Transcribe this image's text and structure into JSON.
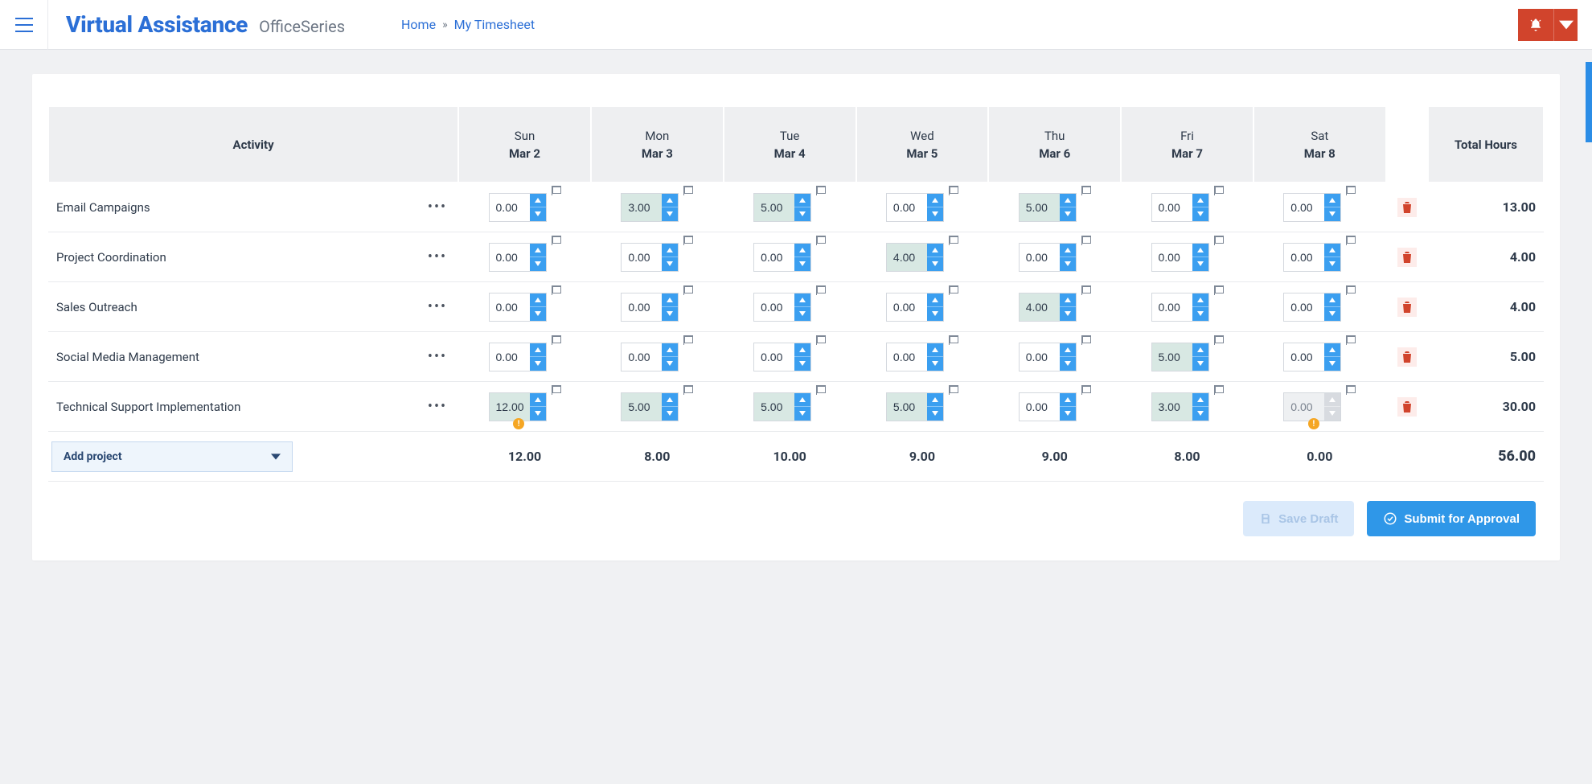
{
  "header": {
    "brand_primary": "Virtual Assistance",
    "brand_secondary": "OfficeSeries",
    "breadcrumb": {
      "home": "Home",
      "current": "My Timesheet"
    }
  },
  "table": {
    "activity_header": "Activity",
    "total_header": "Total Hours",
    "days": [
      {
        "dow": "Sun",
        "date": "Mar 2"
      },
      {
        "dow": "Mon",
        "date": "Mar 3"
      },
      {
        "dow": "Tue",
        "date": "Mar 4"
      },
      {
        "dow": "Wed",
        "date": "Mar 5"
      },
      {
        "dow": "Thu",
        "date": "Mar 6"
      },
      {
        "dow": "Fri",
        "date": "Mar 7"
      },
      {
        "dow": "Sat",
        "date": "Mar 8"
      }
    ],
    "rows": [
      {
        "activity": "Email Campaigns",
        "cells": [
          {
            "value": "0.00",
            "filled": false
          },
          {
            "value": "3.00",
            "filled": true
          },
          {
            "value": "5.00",
            "filled": true
          },
          {
            "value": "0.00",
            "filled": false
          },
          {
            "value": "5.00",
            "filled": true
          },
          {
            "value": "0.00",
            "filled": false
          },
          {
            "value": "0.00",
            "filled": false
          }
        ],
        "total": "13.00"
      },
      {
        "activity": "Project Coordination",
        "cells": [
          {
            "value": "0.00",
            "filled": false
          },
          {
            "value": "0.00",
            "filled": false
          },
          {
            "value": "0.00",
            "filled": false
          },
          {
            "value": "4.00",
            "filled": true
          },
          {
            "value": "0.00",
            "filled": false
          },
          {
            "value": "0.00",
            "filled": false
          },
          {
            "value": "0.00",
            "filled": false
          }
        ],
        "total": "4.00"
      },
      {
        "activity": "Sales Outreach",
        "cells": [
          {
            "value": "0.00",
            "filled": false
          },
          {
            "value": "0.00",
            "filled": false
          },
          {
            "value": "0.00",
            "filled": false
          },
          {
            "value": "0.00",
            "filled": false
          },
          {
            "value": "4.00",
            "filled": true
          },
          {
            "value": "0.00",
            "filled": false
          },
          {
            "value": "0.00",
            "filled": false
          }
        ],
        "total": "4.00"
      },
      {
        "activity": "Social Media Management",
        "cells": [
          {
            "value": "0.00",
            "filled": false
          },
          {
            "value": "0.00",
            "filled": false
          },
          {
            "value": "0.00",
            "filled": false
          },
          {
            "value": "0.00",
            "filled": false
          },
          {
            "value": "0.00",
            "filled": false
          },
          {
            "value": "5.00",
            "filled": true
          },
          {
            "value": "0.00",
            "filled": false
          }
        ],
        "total": "5.00"
      },
      {
        "activity": "Technical Support Implementation",
        "cells": [
          {
            "value": "12.00",
            "filled": true,
            "warn": true
          },
          {
            "value": "5.00",
            "filled": true
          },
          {
            "value": "5.00",
            "filled": true
          },
          {
            "value": "5.00",
            "filled": true
          },
          {
            "value": "0.00",
            "filled": false
          },
          {
            "value": "3.00",
            "filled": true
          },
          {
            "value": "0.00",
            "filled": false,
            "disabled": true,
            "warn": true
          }
        ],
        "total": "30.00"
      }
    ],
    "day_totals": [
      "12.00",
      "8.00",
      "10.00",
      "9.00",
      "9.00",
      "8.00",
      "0.00"
    ],
    "grand_total": "56.00",
    "add_project": "Add project"
  },
  "actions": {
    "save": "Save Draft",
    "submit": "Submit for Approval"
  }
}
